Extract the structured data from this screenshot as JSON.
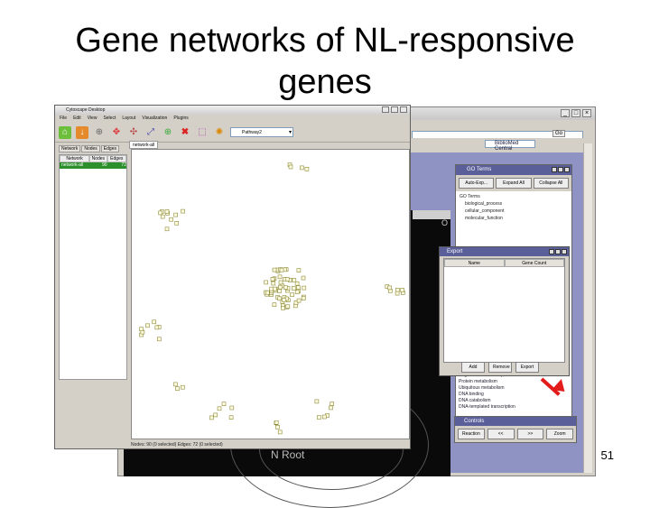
{
  "slide": {
    "title_line1": "Gene networks of NL-responsive",
    "title_line2": "genes",
    "page_number": "51"
  },
  "cytoscape": {
    "window_title": "Cytoscape Desktop",
    "menu": [
      "File",
      "Edit",
      "View",
      "Select",
      "Layout",
      "Visualization",
      "Plugins"
    ],
    "layout_select_value": "Pathway2",
    "network_tabs": [
      "Network",
      "Nodes",
      "Edges"
    ],
    "network_row": {
      "name": "network-all",
      "nodes": "90",
      "edges": "72"
    },
    "canvas_tab": "network-all",
    "status": "Nodes: 90 (0 selected) Edges: 72 (0 selected)"
  },
  "go_panel": {
    "title": "GO Terms",
    "buttons": [
      "Auto-Exp...",
      "Expand All",
      "Collapse All"
    ],
    "tree_root": "GO Terms",
    "tree_items": [
      "biological_process",
      "cellular_component",
      "molecular_function"
    ],
    "list_items": [
      "Regulation of transcription",
      "Protein metabolism",
      "Ubiquitous metabolism",
      "DNA binding",
      "DNA catabolism",
      "DNA-templated transcription"
    ]
  },
  "export_dialog": {
    "title": "Export",
    "columns": [
      "Name",
      "Gene Count"
    ],
    "buttons": [
      "Add",
      "Remove",
      "Export"
    ]
  },
  "results_panel": {
    "title": "Controls",
    "buttons": [
      "Reaction",
      "<<",
      ">>",
      "Zoom"
    ]
  },
  "background": {
    "search_label": "BiblioMed Central",
    "go_button": "Go",
    "tree_root_label": "N Root",
    "panel_label": "O"
  }
}
